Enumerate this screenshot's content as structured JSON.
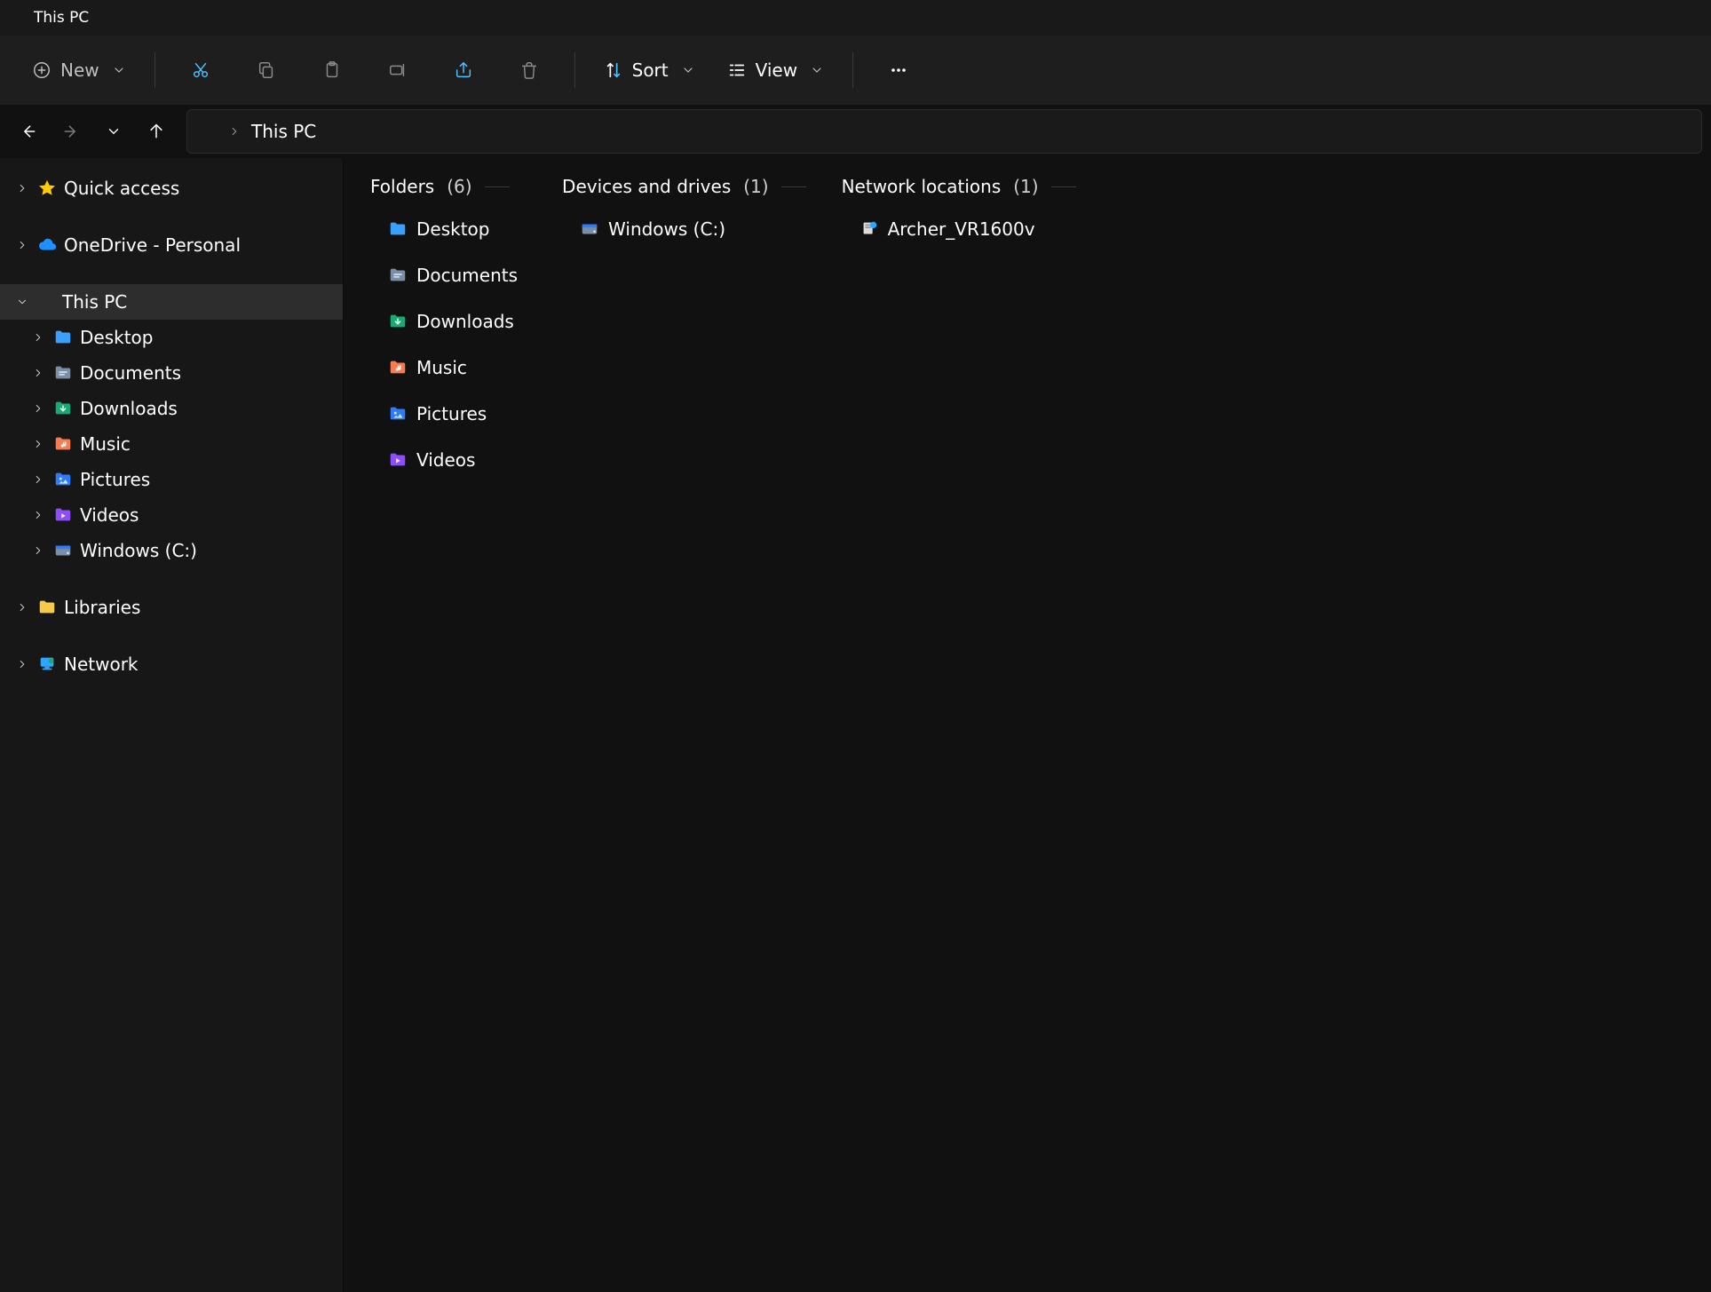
{
  "window": {
    "title": "This PC"
  },
  "toolbar": {
    "new": "New",
    "sort": "Sort",
    "view": "View"
  },
  "address": {
    "location": "This PC"
  },
  "sidebar": {
    "quick_access": "Quick access",
    "onedrive": "OneDrive - Personal",
    "this_pc": "This PC",
    "this_pc_children": {
      "desktop": "Desktop",
      "documents": "Documents",
      "downloads": "Downloads",
      "music": "Music",
      "pictures": "Pictures",
      "videos": "Videos",
      "c_drive": "Windows (C:)"
    },
    "libraries": "Libraries",
    "network": "Network"
  },
  "content": {
    "groups": {
      "folders": {
        "title": "Folders",
        "count": "(6)"
      },
      "drives": {
        "title": "Devices and drives",
        "count": "(1)"
      },
      "network": {
        "title": "Network locations",
        "count": "(1)"
      }
    },
    "folders": {
      "desktop": "Desktop",
      "documents": "Documents",
      "downloads": "Downloads",
      "music": "Music",
      "pictures": "Pictures",
      "videos": "Videos"
    },
    "drives": {
      "c": "Windows (C:)"
    },
    "network": {
      "router": "Archer_VR1600v"
    }
  }
}
